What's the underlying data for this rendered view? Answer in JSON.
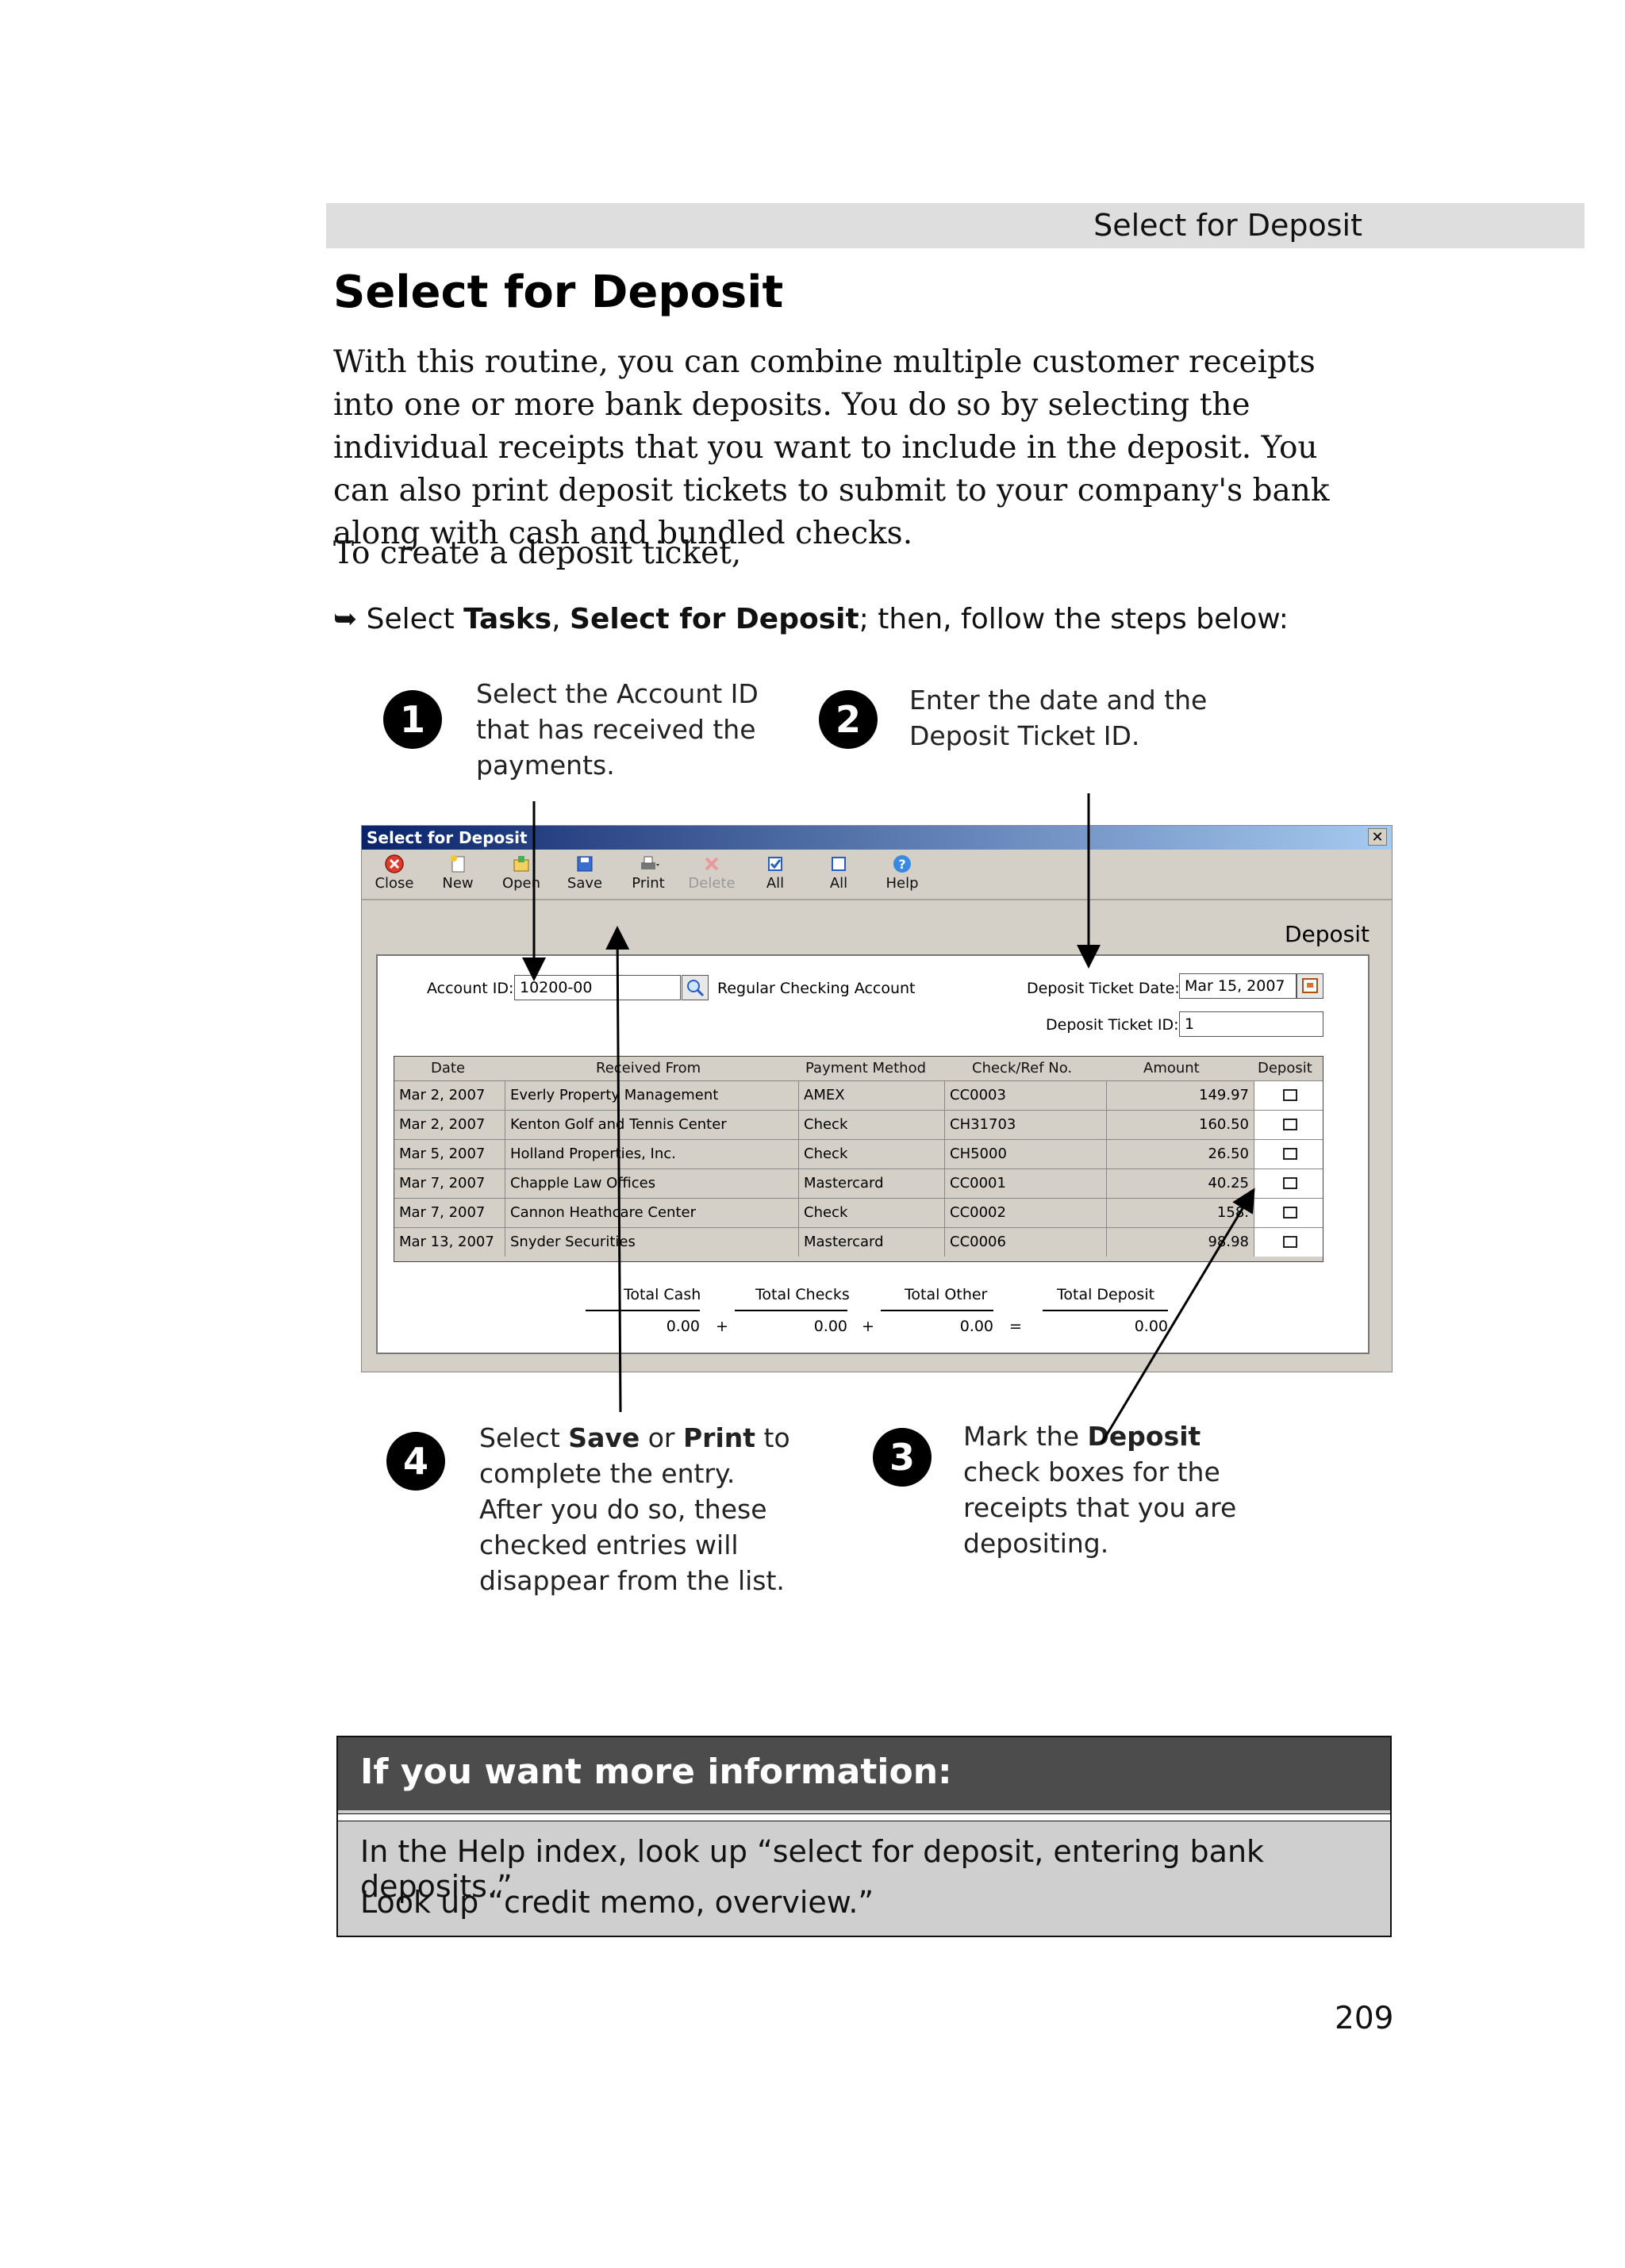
{
  "running_header": "Select for Deposit",
  "title": "Select for Deposit",
  "intro": "With this routine, you can combine multiple customer receipts into one or more bank deposits. You do so by selecting the individual receipts that you want to include in the deposit. You can also print deposit tickets to submit to your company's bank along with cash and bundled checks.",
  "lead": "To create a deposit ticket,",
  "instruction": {
    "bullet": "➥",
    "prefix": "Select ",
    "b1": "Tasks",
    "sep": ", ",
    "b2": "Select for Deposit",
    "suffix": "; then, follow the steps below:"
  },
  "callouts": {
    "c1": {
      "num": "1",
      "lines": [
        "Select the Account ID",
        "that has received the",
        "payments."
      ]
    },
    "c2": {
      "num": "2",
      "lines": [
        "Enter the date and the",
        "Deposit Ticket ID."
      ]
    },
    "c3": {
      "num": "3",
      "pre": "Mark the ",
      "bold": "Deposit",
      "lines": [
        "check boxes for the",
        "receipts that you are",
        "depositing."
      ]
    },
    "c4": {
      "num": "4",
      "pre": "Select ",
      "b1": "Save",
      "mid": " or ",
      "b2": "Print",
      "post": " to",
      "lines": [
        "complete the entry.",
        "After you do so, these",
        "checked entries will",
        "disappear from the list."
      ]
    }
  },
  "window": {
    "title": "Select for Deposit",
    "close_glyph": "✕",
    "toolbar": [
      "Close",
      "New",
      "Open",
      "Save",
      "Print",
      "Delete",
      "All",
      "All",
      "Help"
    ],
    "heading": "Deposit",
    "account_label": "Account ID:",
    "account_value": "10200-00",
    "account_name": "Regular Checking Account",
    "date_label": "Deposit Ticket Date:",
    "date_value": "Mar 15, 2007",
    "ticket_label": "Deposit Ticket ID:",
    "ticket_value": "1",
    "columns": [
      "Date",
      "Received From",
      "Payment Method",
      "Check/Ref No.",
      "Amount",
      "Deposit"
    ],
    "rows": [
      {
        "date": "Mar 2, 2007",
        "from": "Everly Property Management",
        "method": "AMEX",
        "ref": "CC0003",
        "amount": "149.97"
      },
      {
        "date": "Mar 2, 2007",
        "from": "Kenton Golf and Tennis Center",
        "method": "Check",
        "ref": "CH31703",
        "amount": "160.50"
      },
      {
        "date": "Mar 5, 2007",
        "from": "Holland Properties, Inc.",
        "method": "Check",
        "ref": "CH5000",
        "amount": "26.50"
      },
      {
        "date": "Mar 7, 2007",
        "from": "Chapple Law Offices",
        "method": "Mastercard",
        "ref": "CC0001",
        "amount": "40.25"
      },
      {
        "date": "Mar 7, 2007",
        "from": "Cannon Heathcare Center",
        "method": "Check",
        "ref": "CC0002",
        "amount": "158."
      },
      {
        "date": "Mar 13, 2007",
        "from": "Snyder Securities",
        "method": "Mastercard",
        "ref": "CC0006",
        "amount": "98.98"
      }
    ],
    "totals": {
      "labels": [
        "Total Cash",
        "Total Checks",
        "Total Other",
        "Total Deposit"
      ],
      "values": [
        "0.00",
        "0.00",
        "0.00",
        "0.00"
      ],
      "ops": [
        "+",
        "+",
        "="
      ]
    }
  },
  "info": {
    "heading": "If you want more information:",
    "lines": [
      "In the Help index, look up “select for deposit, entering bank deposits.”",
      "Look up “credit memo, overview.”"
    ]
  },
  "page_number": "209"
}
